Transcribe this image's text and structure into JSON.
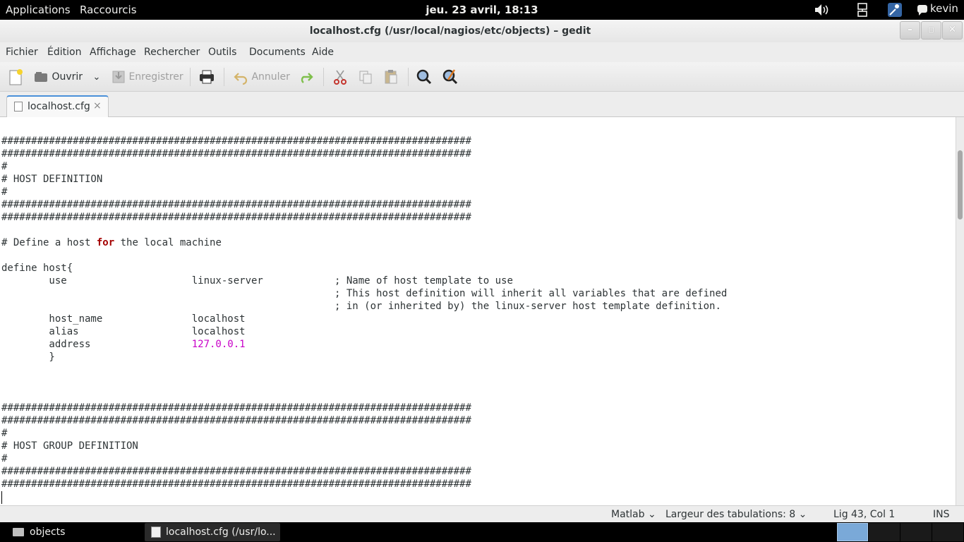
{
  "top_panel": {
    "applications": "Applications",
    "shortcuts": "Raccourcis",
    "clock": "jeu. 23 avril, 18:13",
    "user": "kevin",
    "tray_icons": [
      "volume-icon",
      "network-icon",
      "accessibility-icon",
      "chat-icon"
    ]
  },
  "window": {
    "title": "localhost.cfg (/usr/local/nagios/etc/objects) – gedit",
    "controls": {
      "minimize": "–",
      "maximize": "▫",
      "close": "✕"
    }
  },
  "menubar": [
    "Fichier",
    "Édition",
    "Affichage",
    "Rechercher",
    "Outils",
    "Documents",
    "Aide"
  ],
  "toolbar": {
    "open_label": "Ouvrir",
    "save_label": "Enregistrer",
    "undo_label": "Annuler",
    "icons": [
      "new-document-icon",
      "open-icon",
      "save-icon",
      "print-icon",
      "undo-icon",
      "redo-icon",
      "cut-icon",
      "copy-icon",
      "paste-icon",
      "search-icon",
      "replace-icon"
    ]
  },
  "tabs": [
    {
      "label": "localhost.cfg",
      "close": "×"
    }
  ],
  "editor": {
    "lines": [
      {
        "t": "###############################################################################"
      },
      {
        "t": "###############################################################################"
      },
      {
        "t": "#"
      },
      {
        "t": "# HOST DEFINITION"
      },
      {
        "t": "#"
      },
      {
        "t": "###############################################################################"
      },
      {
        "t": "###############################################################################"
      },
      {
        "t": ""
      },
      {
        "pre": "# Define a host ",
        "kw": "for",
        "post": " the local machine"
      },
      {
        "t": ""
      },
      {
        "t": "define host{"
      },
      {
        "t": "        use                     linux-server            ; Name of host template to use"
      },
      {
        "t": "                                                        ; This host definition will inherit all variables that are defined"
      },
      {
        "t": "                                                        ; in (or inherited by) the linux-server host template definition."
      },
      {
        "t": "        host_name               localhost"
      },
      {
        "t": "        alias                   localhost"
      },
      {
        "pre": "        address                 ",
        "num": "127.0.0.1"
      },
      {
        "t": "        }"
      },
      {
        "t": ""
      },
      {
        "t": ""
      },
      {
        "t": ""
      },
      {
        "t": "###############################################################################"
      },
      {
        "t": "###############################################################################"
      },
      {
        "t": "#"
      },
      {
        "t": "# HOST GROUP DEFINITION"
      },
      {
        "t": "#"
      },
      {
        "t": "###############################################################################"
      },
      {
        "t": "###############################################################################"
      }
    ],
    "keyword_color": "#a40000",
    "number_color": "#c800c8"
  },
  "statusbar": {
    "language": "Matlab",
    "tab_width_label": "Largeur des tabulations:",
    "tab_width": "8",
    "position": "Lig 43, Col 1",
    "mode": "INS"
  },
  "taskbar": {
    "items": [
      {
        "label": "objects"
      },
      {
        "label": "localhost.cfg (/usr/lo..."
      }
    ]
  }
}
